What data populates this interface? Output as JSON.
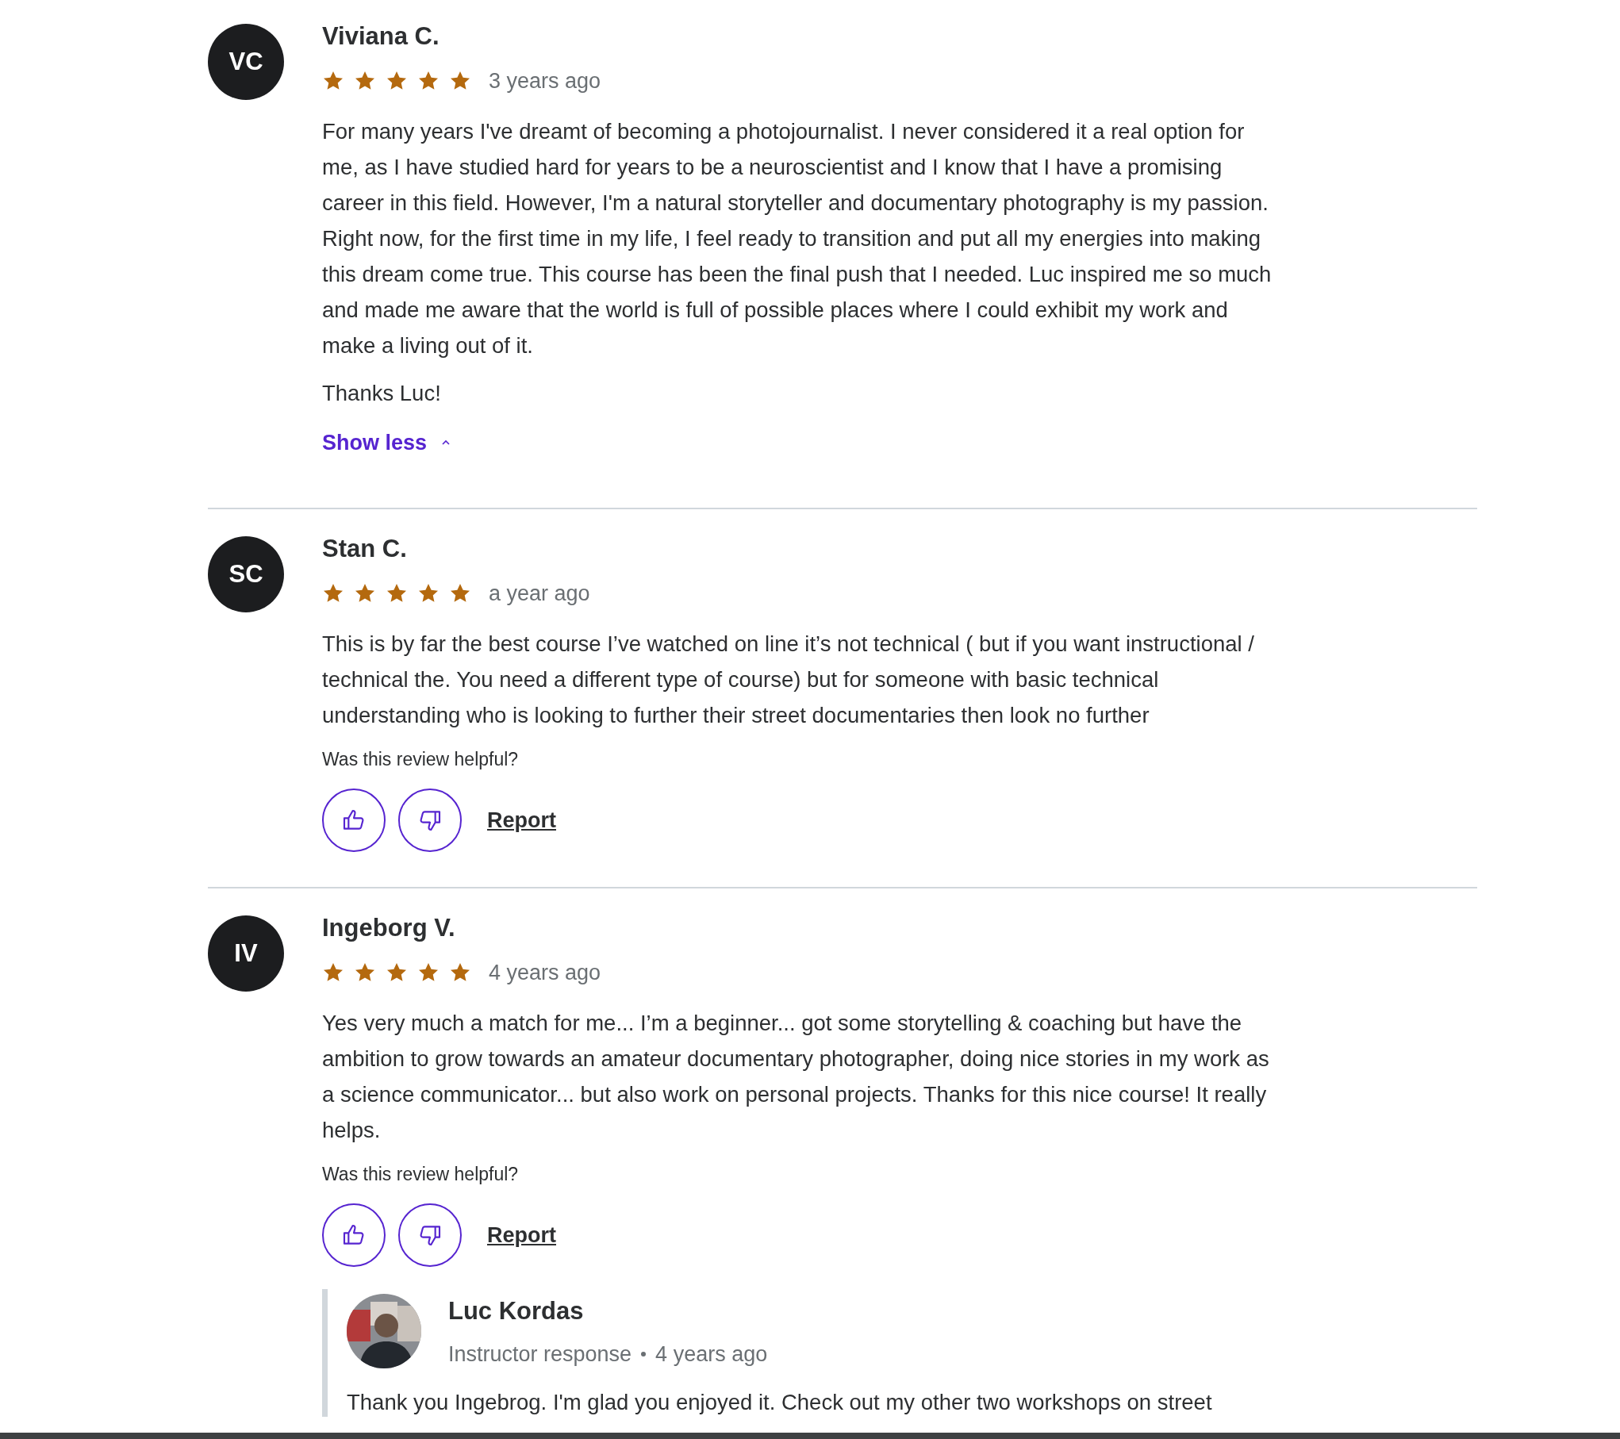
{
  "reviews": [
    {
      "initials": "VC",
      "name": "Viviana C.",
      "stars": 5,
      "time": "3 years ago",
      "paragraphs": [
        "For many years I've dreamt of becoming a photojournalist. I never considered it a real option for me, as I have studied hard for years to be a neuroscientist and I know that I have a promising career in this field. However, I'm a natural storyteller and documentary photography is my passion. Right now, for the first time in my life, I feel ready to transition and put all my energies into making this dream come true. This course has been the final push that I needed. Luc inspired me so much and made me aware that the world is full of possible places where I could exhibit my work and make a living out of it.",
        "Thanks Luc!"
      ],
      "toggle": "Show less"
    },
    {
      "initials": "SC",
      "name": "Stan C.",
      "stars": 5,
      "time": "a year ago",
      "paragraphs": [
        "This is by far the best course I’ve watched on line it’s not technical ( but if you want instructional / technical the. You need a different type of course) but for someone with basic technical understanding who is looking to further their street documentaries then look no further"
      ],
      "helpful": "Was this review helpful?",
      "report": "Report"
    },
    {
      "initials": "IV",
      "name": "Ingeborg V.",
      "stars": 5,
      "time": "4 years ago",
      "paragraphs": [
        "Yes very much a match for me... I’m a beginner... got some storytelling & coaching but have the ambition to grow towards an amateur documentary photographer, doing nice stories in my work as a science communicator... but also work on personal projects. Thanks for this nice course! It really helps."
      ],
      "helpful": "Was this review helpful?",
      "report": "Report",
      "response": {
        "name": "Luc Kordas",
        "role": "Instructor response",
        "time": "4 years ago",
        "text": "Thank you Ingebrog. I'm glad you enjoyed it. Check out my other two workshops on street"
      }
    }
  ]
}
